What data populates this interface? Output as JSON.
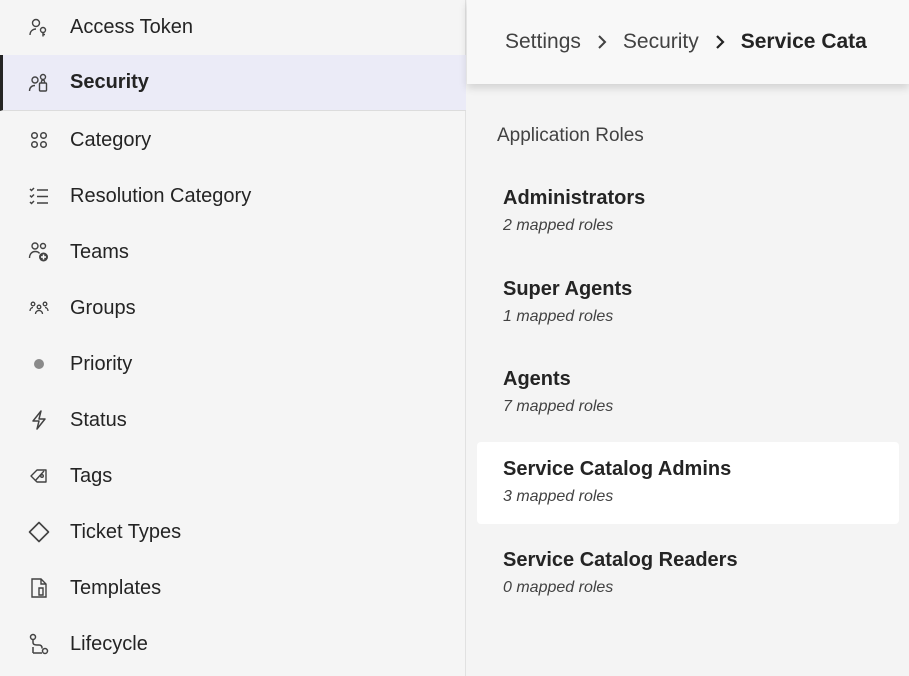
{
  "sidebar": {
    "items": [
      {
        "label": "Access Token",
        "icon": "access-token-icon"
      },
      {
        "label": "Security",
        "icon": "security-icon",
        "active": true
      },
      {
        "label": "Category",
        "icon": "category-grid-icon"
      },
      {
        "label": "Resolution Category",
        "icon": "checklist-icon"
      },
      {
        "label": "Teams",
        "icon": "teams-add-icon"
      },
      {
        "label": "Groups",
        "icon": "groups-icon"
      },
      {
        "label": "Priority",
        "icon": "dot-icon"
      },
      {
        "label": "Status",
        "icon": "lightning-icon"
      },
      {
        "label": "Tags",
        "icon": "tag-icon"
      },
      {
        "label": "Ticket Types",
        "icon": "diamond-tag-icon"
      },
      {
        "label": "Templates",
        "icon": "document-icon"
      },
      {
        "label": "Lifecycle",
        "icon": "flow-icon"
      }
    ]
  },
  "breadcrumb": {
    "items": [
      "Settings",
      "Security",
      "Service Cata"
    ]
  },
  "main": {
    "section_title": "Application Roles",
    "roles": [
      {
        "name": "Administrators",
        "count": "2 mapped roles"
      },
      {
        "name": "Super Agents",
        "count": "1 mapped roles"
      },
      {
        "name": "Agents",
        "count": "7 mapped roles"
      },
      {
        "name": "Service Catalog Admins",
        "count": "3 mapped roles",
        "selected": true
      },
      {
        "name": "Service Catalog Readers",
        "count": "0 mapped roles"
      }
    ]
  },
  "colors": {
    "active_bg": "#ebebf7",
    "sidebar_bg": "#f5f5f5",
    "selected_card": "#ffffff"
  }
}
